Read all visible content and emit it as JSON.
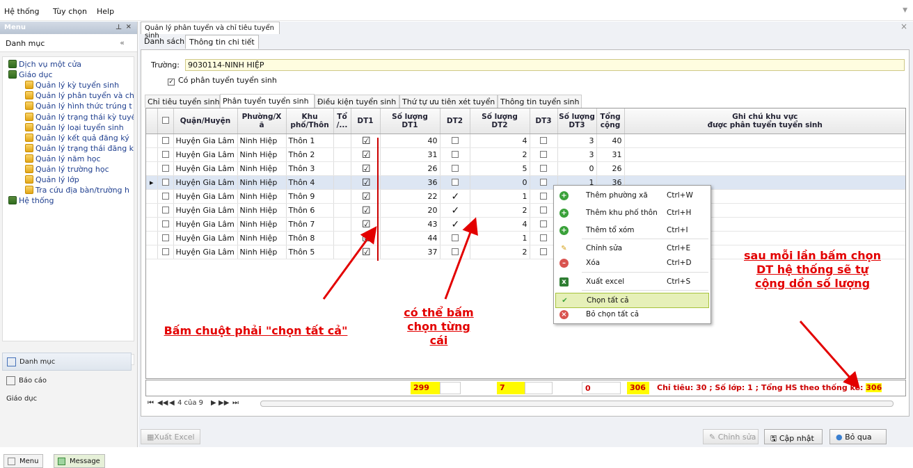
{
  "menubar": {
    "items": [
      "Hệ thống",
      "Tùy chọn",
      "Help"
    ]
  },
  "left": {
    "title": "Menu",
    "category": "Danh mục",
    "tree": [
      {
        "label": "Dịch vụ một cửa",
        "level": 0,
        "icon": "database-icon"
      },
      {
        "label": "Giáo dục",
        "level": 0,
        "icon": "database-icon"
      },
      {
        "label": "Quản lý kỳ tuyển sinh",
        "level": 1,
        "icon": "document-icon"
      },
      {
        "label": "Quản lý phân tuyển và ch",
        "level": 1,
        "icon": "document-icon"
      },
      {
        "label": "Quản lý hình thức trúng t",
        "level": 1,
        "icon": "document-icon"
      },
      {
        "label": "Quản lý trạng thái kỳ tuyể",
        "level": 1,
        "icon": "document-icon"
      },
      {
        "label": "Quản lý loại tuyển sinh",
        "level": 1,
        "icon": "document-icon"
      },
      {
        "label": "Quản lý kết quả đăng ký",
        "level": 1,
        "icon": "document-icon"
      },
      {
        "label": "Quản lý trạng thái đăng k",
        "level": 1,
        "icon": "document-icon"
      },
      {
        "label": "Quản lý năm học",
        "level": 1,
        "icon": "document-icon"
      },
      {
        "label": "Quản lý trường học",
        "level": 1,
        "icon": "document-icon"
      },
      {
        "label": "Quản lý lớp",
        "level": 1,
        "icon": "document-icon"
      },
      {
        "label": "Tra cứu địa bàn/trường h",
        "level": 1,
        "icon": "document-icon"
      },
      {
        "label": "Hệ thống",
        "level": 0,
        "icon": "database-icon"
      }
    ],
    "nav": {
      "danhmuc": "Danh mục",
      "baocao": "Báo cáo",
      "giaoduc": "Giáo dục"
    },
    "bottom_tabs": {
      "menu": "Menu",
      "message": "Message"
    }
  },
  "main": {
    "doc_tab": "Quản lý phân tuyển và chỉ tiêu tuyển sinh",
    "tabs": {
      "list": "Danh sách",
      "detail": "Thông tin chi tiết"
    },
    "truong_label": "Trường:",
    "truong_value": "9030114-NINH HIỆP",
    "co_phan_tuyen": "Có phân tuyển tuyển sinh",
    "inner_tabs": [
      "Chỉ tiêu tuyển sinh",
      "Phân tuyển tuyển sinh",
      "Điều kiện tuyển sinh",
      "Thứ tự ưu tiên xét tuyển",
      "Thông tin tuyển sinh"
    ],
    "columns": {
      "quan": "Quận/Huyện",
      "phuong1": "Phường/X",
      "phuong2": "ã",
      "khu1": "Khu",
      "khu2": "phố/Thôn",
      "to1": "Tổ",
      "to2": "/...",
      "dt1": "DT1",
      "sl1a": "Số lượng",
      "sl1b": "DT1",
      "dt2": "DT2",
      "sl2a": "Số lượng",
      "sl2b": "DT2",
      "dt3": "DT3",
      "sl3a": "Số lượng",
      "sl3b": "DT3",
      "tong1": "Tổng",
      "tong2": "cộng",
      "ghichu1": "Ghi chú khu vực",
      "ghichu2": "được phân tuyển tuyển sinh"
    },
    "rows": [
      {
        "quan": "Huyện Gia Lâm",
        "phuong": "Ninh Hiệp",
        "thon": "Thôn 1",
        "dt1": "☑",
        "sl1": "40",
        "dt2": "",
        "sl2": "4",
        "dt3": "",
        "sl3": "3",
        "tong": "40"
      },
      {
        "quan": "Huyện Gia Lâm",
        "phuong": "Ninh Hiệp",
        "thon": "Thôn 2",
        "dt1": "☑",
        "sl1": "31",
        "dt2": "",
        "sl2": "2",
        "dt3": "",
        "sl3": "3",
        "tong": "31"
      },
      {
        "quan": "Huyện Gia Lâm",
        "phuong": "Ninh Hiệp",
        "thon": "Thôn 3",
        "dt1": "☑",
        "sl1": "26",
        "dt2": "",
        "sl2": "5",
        "dt3": "",
        "sl3": "0",
        "tong": "26"
      },
      {
        "quan": "Huyện Gia Lâm",
        "phuong": "Ninh Hiệp",
        "thon": "Thôn 4",
        "dt1": "☑",
        "sl1": "36",
        "dt2": "",
        "sl2": "0",
        "dt3": "",
        "sl3": "1",
        "tong": "36"
      },
      {
        "quan": "Huyện Gia Lâm",
        "phuong": "Ninh Hiệp",
        "thon": "Thôn 9",
        "dt1": "☑",
        "sl1": "22",
        "dt2": "✓",
        "sl2": "1",
        "dt3": "",
        "sl3": "",
        "tong": ""
      },
      {
        "quan": "Huyện Gia Lâm",
        "phuong": "Ninh Hiệp",
        "thon": "Thôn 6",
        "dt1": "☑",
        "sl1": "20",
        "dt2": "✓",
        "sl2": "2",
        "dt3": "",
        "sl3": "",
        "tong": ""
      },
      {
        "quan": "Huyện Gia Lâm",
        "phuong": "Ninh Hiệp",
        "thon": "Thôn 7",
        "dt1": "☑",
        "sl1": "43",
        "dt2": "✓",
        "sl2": "4",
        "dt3": "",
        "sl3": "",
        "tong": ""
      },
      {
        "quan": "Huyện Gia Lâm",
        "phuong": "Ninh Hiệp",
        "thon": "Thôn 8",
        "dt1": "☑",
        "sl1": "44",
        "dt2": "",
        "sl2": "1",
        "dt3": "",
        "sl3": "",
        "tong": ""
      },
      {
        "quan": "Huyện Gia Lâm",
        "phuong": "Ninh Hiệp",
        "thon": "Thôn 5",
        "dt1": "☑",
        "sl1": "37",
        "dt2": "",
        "sl2": "2",
        "dt3": "",
        "sl3": "",
        "tong": ""
      }
    ],
    "totals": {
      "sl1": "299",
      "sl2": "7",
      "sl3": "0",
      "tong": "306",
      "summary_prefix": "Chỉ tiêu: 30 ; Số lớp: 1 ; Tổng HS theo thống kê:",
      "summary_value": "306"
    },
    "pager": {
      "text": "4 của 9",
      "first": "⏮",
      "prev_page": "◀◀",
      "prev": "◀",
      "next": "▶",
      "next_page": "▶▶",
      "last": "⏭"
    },
    "buttons": {
      "export": "Xuất Excel",
      "edit": "Chỉnh sửa",
      "update": "Cập nhật",
      "cancel": "Bỏ qua"
    }
  },
  "context_menu": [
    {
      "label": "Thêm phường xã",
      "shortcut": "Ctrl+W",
      "icon": "add-icon"
    },
    {
      "label": "Thêm khu phố thôn",
      "shortcut": "Ctrl+H",
      "icon": "add-icon"
    },
    {
      "label": "Thêm tổ xóm",
      "shortcut": "Ctrl+I",
      "icon": "add-icon"
    },
    {
      "label": "Chỉnh sửa",
      "shortcut": "Ctrl+E",
      "icon": "pencil-icon"
    },
    {
      "label": "Xóa",
      "shortcut": "Ctrl+D",
      "icon": "minus-icon"
    },
    {
      "label": "Xuất excel",
      "shortcut": "Ctrl+S",
      "icon": "excel-icon"
    },
    {
      "label": "Chọn tất cả",
      "shortcut": "",
      "icon": "check-icon"
    },
    {
      "label": "Bỏ chọn tất cả",
      "shortcut": "",
      "icon": "cross-icon"
    }
  ],
  "annotations": {
    "right_click": "Bấm chuột phải \"chọn tất cả\"",
    "each": "có thể bấm chọn từng cái",
    "auto_sum": "sau mỗi lần bấm chọn DT hệ thống sẽ tự cộng dồn số lượng"
  },
  "colors": {
    "annotation": "#e30000",
    "highlight_yellow": "#fffb00",
    "total_text": "#cc0000"
  }
}
